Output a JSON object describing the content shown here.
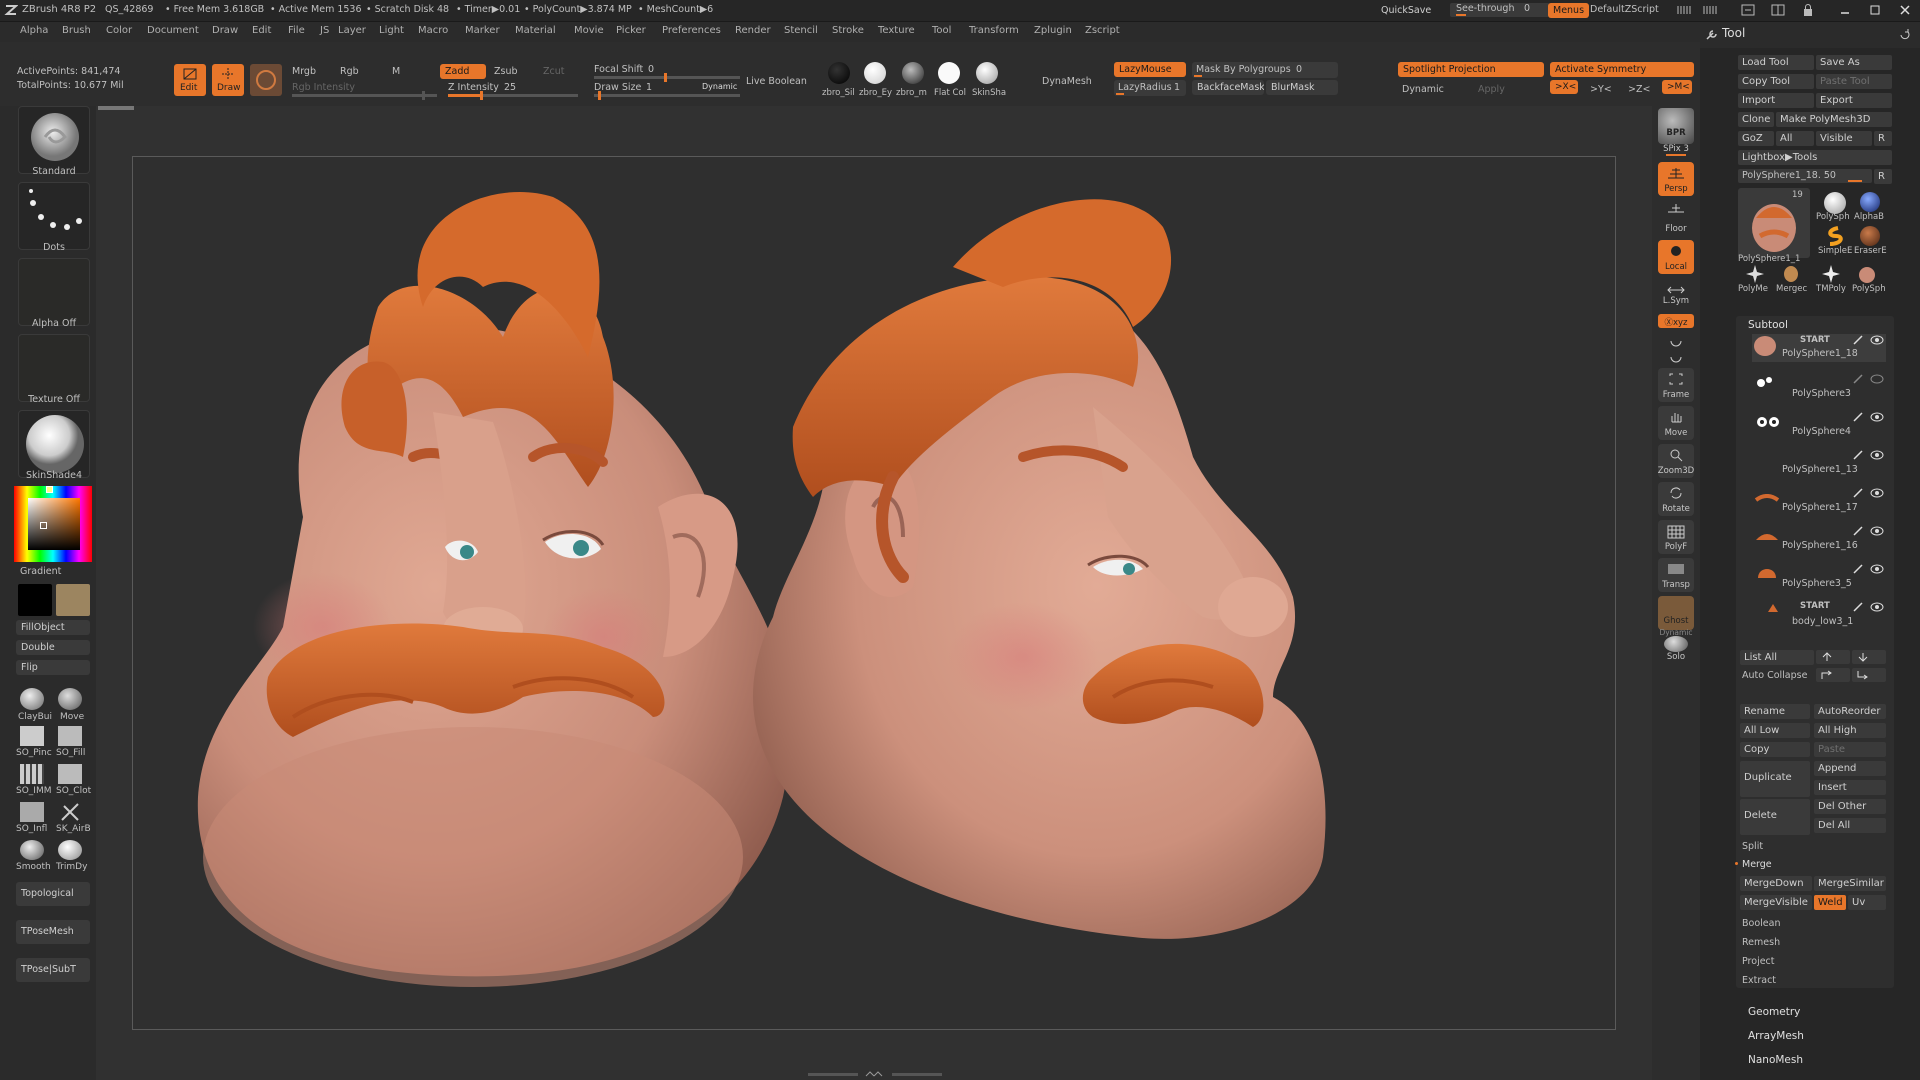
{
  "app": {
    "title": "ZBrush 4R8 P2",
    "stats": [
      "QS_42869",
      "• Free Mem 3.618GB",
      "• Active Mem 1536",
      "• Scratch Disk 48",
      "• Timer▶0.01",
      "• PolyCount▶3.874 MP",
      "• MeshCount▶6"
    ],
    "quicksave": "QuickSave",
    "see_through": "See-through",
    "see_through_value": "0",
    "menus_btn": "Menus",
    "default_zscript": "DefaultZScript"
  },
  "menubar": [
    "Alpha",
    "Brush",
    "Color",
    "Document",
    "Draw",
    "Edit",
    "File",
    "JS",
    "Layer",
    "Light",
    "Macro",
    "Marker",
    "Material",
    "Movie",
    "Picker",
    "Preferences",
    "Render",
    "Stencil",
    "Stroke",
    "Texture",
    "Tool",
    "Transform",
    "Zplugin",
    "Zscript"
  ],
  "topshelf": {
    "active_points": "ActivePoints: 841,474",
    "total_points": "TotalPoints: 10.677 Mil",
    "edit": "Edit",
    "draw": "Draw",
    "mrgb": "Mrgb",
    "rgb": "Rgb",
    "m": "M",
    "rgb_intensity": "Rgb Intensity",
    "zadd": "Zadd",
    "zsub": "Zsub",
    "zcut": "Zcut",
    "z_intensity": "Z Intensity",
    "z_intensity_value": "25",
    "focal_shift": "Focal Shift",
    "focal_shift_value": "0",
    "draw_size": "Draw Size",
    "draw_size_value": "1",
    "dynamic": "Dynamic",
    "live_boolean": "Live Boolean",
    "materials": [
      "zbro_Sil",
      "zbro_Ey",
      "zbro_m",
      "Flat Col",
      "SkinSha"
    ],
    "dynamesh": "DynaMesh",
    "lazymouse": "LazyMouse",
    "lazyradius": "LazyRadius",
    "lazyradius_value": "1",
    "mask_by_polygroups": "Mask By Polygroups",
    "mask_by_polygroups_value": "0",
    "backface_mask": "BackfaceMask",
    "blur_mask": "BlurMask",
    "spotlight_projection": "Spotlight Projection",
    "activate_symmetry": "Activate Symmetry",
    "dynamic2": "Dynamic",
    "apply": "Apply",
    "sym_x": ">X<",
    "sym_y": ">Y<",
    "sym_z": ">Z<",
    "sym_m": ">M<"
  },
  "leftpanel": {
    "brush": "Standard",
    "stroke": "Dots",
    "alpha": "Alpha Off",
    "texture": "Texture Off",
    "material": "SkinShade4",
    "gradient": "Gradient",
    "fill_object": "FillObject",
    "double": "Double",
    "flip": "Flip",
    "brushes": [
      "ClayBui",
      "Move",
      "SO_Pinc",
      "SO_Fill",
      "SO_IMM",
      "SO_Clot",
      "SO_Infl",
      "SK_AirB",
      "Smooth",
      "TrimDy"
    ],
    "topological": "Topological",
    "tposemesh": "TPoseMesh",
    "tpose_subt": "TPose|SubT",
    "secondary_color": "#9c8560"
  },
  "rightshelf": {
    "bpr": "BPR",
    "spix": "SPix 3",
    "persp": "Persp",
    "floor": "Floor",
    "local": "Local",
    "lsym": "L.Sym",
    "xyz": "Ⓧxyz",
    "frame": "Frame",
    "move": "Move",
    "zoom3d": "Zoom3D",
    "rotate": "Rotate",
    "polyf": "PolyF",
    "transp": "Transp",
    "ghost": "Ghost",
    "solo": "Solo",
    "dynamic": "Dynamic"
  },
  "tray": {
    "title": "Tool",
    "load_tool": "Load Tool",
    "save_as": "Save As",
    "copy_tool": "Copy Tool",
    "paste_tool": "Paste Tool",
    "import": "Import",
    "export": "Export",
    "clone": "Clone",
    "make_polymesh": "Make PolyMesh3D",
    "goz": "GoZ",
    "all": "All",
    "visible": "Visible",
    "r": "R",
    "lightbox_tools": "Lightbox▶Tools",
    "current_tool": "PolySphere1_18. 50",
    "tool_count": "19",
    "tool_thumbs": [
      "PolySphere1_1",
      "PolySph",
      "AlphaB",
      "SimpleE",
      "EraserE",
      "PolyMe",
      "Mergec",
      "TMPoly",
      "PolySph"
    ],
    "subtool_header": "Subtool",
    "subtools": [
      "PolySphere1_18",
      "PolySphere3",
      "PolySphere4",
      "PolySphere1_13",
      "PolySphere1_17",
      "PolySphere1_16",
      "PolySphere3_5",
      "body_low3_1"
    ],
    "start": "START",
    "list_all": "List All",
    "auto_collapse": "Auto Collapse",
    "rename": "Rename",
    "autoreorder": "AutoReorder",
    "all_low": "All Low",
    "all_high": "All High",
    "copy": "Copy",
    "paste": "Paste",
    "duplicate": "Duplicate",
    "append": "Append",
    "insert": "Insert",
    "delete": "Delete",
    "del_other": "Del Other",
    "del_all": "Del All",
    "split": "Split",
    "merge": "Merge",
    "mergedown": "MergeDown",
    "mergesimilar": "MergeSimilar",
    "mergevisible": "MergeVisible",
    "weld": "Weld",
    "uv": "Uv",
    "boolean": "Boolean",
    "remesh": "Remesh",
    "project": "Project",
    "extract": "Extract",
    "geometry": "Geometry",
    "arraymesh": "ArrayMesh",
    "nanomesh": "NanoMesh"
  },
  "colors": {
    "accent": "#e8762a",
    "hair": "#d2692f",
    "skin": "#d89a84"
  }
}
